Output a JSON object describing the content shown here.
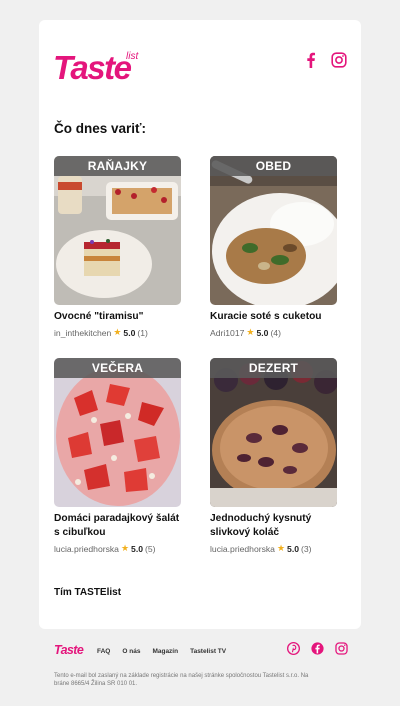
{
  "brand": {
    "logo_text": "Taste",
    "logo_sub": "list",
    "accent": "#e4157c"
  },
  "social_top": [
    "facebook-icon",
    "instagram-icon"
  ],
  "heading": "Čo dnes variť:",
  "recipes": [
    {
      "category": "RAŇAJKY",
      "title": "Ovocné \"tiramisu\"",
      "author": "in_inthekitchen",
      "rating": "5.0",
      "count": "(1)"
    },
    {
      "category": "OBED",
      "title": "Kuracie soté s cuketou",
      "author": "Adri1017",
      "rating": "5.0",
      "count": "(4)"
    },
    {
      "category": "VEČERA",
      "title": "Domáci paradajkový šalát s cibuľkou",
      "author": "lucia.priedhorska",
      "rating": "5.0",
      "count": "(5)"
    },
    {
      "category": "DEZERT",
      "title": "Jednoduchý kysnutý slivkový koláč",
      "author": "lucia.priedhorska",
      "rating": "5.0",
      "count": "(3)"
    }
  ],
  "team": "Tím TASTElist",
  "footer": {
    "logo_text": "Taste",
    "nav": [
      "FAQ",
      "O nás",
      "Magazín",
      "Tastelist TV"
    ],
    "social": [
      "pinterest-icon",
      "facebook-icon",
      "instagram-icon"
    ],
    "note": "Tento e-mail bol zaslaný na základe registrácie na našej stránke spoločnostou Tastelist s.r.o. Na bráne 8665/4 Žilina SR 010 01."
  }
}
